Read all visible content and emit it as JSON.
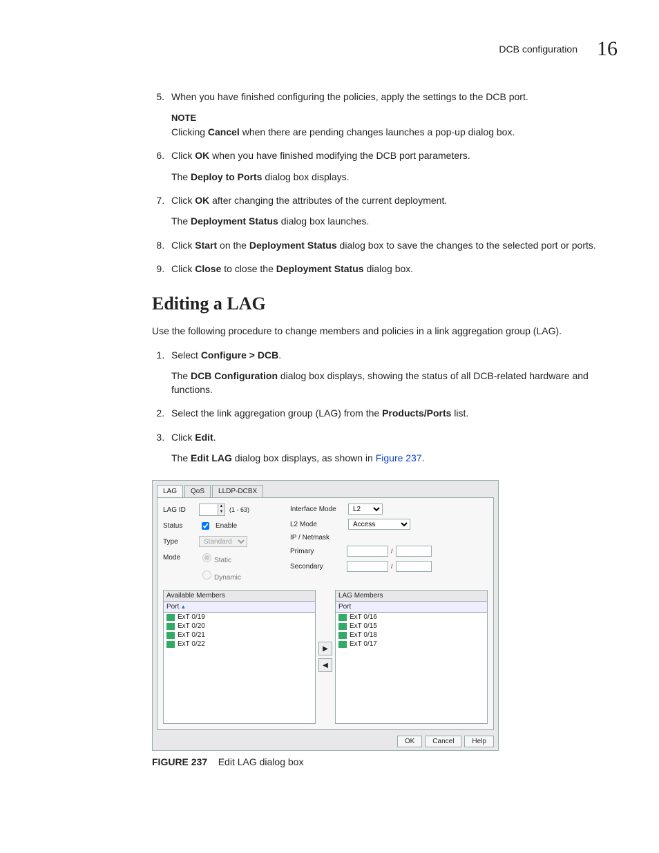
{
  "header": {
    "title": "DCB configuration",
    "chapter": "16"
  },
  "step5": {
    "text": "When you have finished configuring the policies, apply the settings to the DCB port.",
    "note_label": "NOTE",
    "note_a": "Clicking ",
    "note_bold": "Cancel",
    "note_b": " when there are pending changes launches a pop-up dialog box."
  },
  "step6": {
    "a": "Click ",
    "b1": "OK",
    "c": " when you have finished modifying the DCB port parameters.",
    "sub_a": "The ",
    "sub_b": "Deploy to Ports",
    "sub_c": " dialog box displays."
  },
  "step7": {
    "a": "Click ",
    "b1": "OK",
    "c": " after changing the attributes of the current deployment.",
    "sub_a": "The ",
    "sub_b": "Deployment Status",
    "sub_c": " dialog box launches."
  },
  "step8": {
    "a": "Click ",
    "b1": "Start",
    "c": " on the ",
    "b2": "Deployment Status",
    "d": " dialog box to save the changes to the selected port or ports."
  },
  "step9": {
    "a": "Click ",
    "b1": "Close",
    "c": " to close the ",
    "b2": "Deployment Status",
    "d": " dialog box."
  },
  "section_title": "Editing a LAG",
  "intro": "Use the following procedure to change members and policies in a link aggregation group (LAG).",
  "p1": {
    "a": "Select ",
    "b": "Configure > DCB",
    "c": ".",
    "sub_a": "The ",
    "sub_b": "DCB Configuration",
    "sub_c": " dialog box displays, showing the status of all DCB-related hardware and functions."
  },
  "p2": {
    "a": "Select the link aggregation group (LAG) from the ",
    "b": "Products/Ports",
    "c": " list."
  },
  "p3": {
    "a": "Click ",
    "b": "Edit",
    "c": ".",
    "sub_a": "The ",
    "sub_b": "Edit LAG",
    "sub_c": " dialog box displays, as shown in ",
    "link": "Figure 237",
    "sub_d": "."
  },
  "dialog": {
    "tabs": [
      "LAG",
      "QoS",
      "LLDP-DCBX"
    ],
    "labels": {
      "lag_id": "LAG ID",
      "range": "(1 - 63)",
      "status": "Status",
      "enable": "Enable",
      "type": "Type",
      "type_val": "Standard",
      "mode": "Mode",
      "static": "Static",
      "dynamic": "Dynamic",
      "iface": "Interface Mode",
      "iface_val": "L2",
      "l2mode": "L2 Mode",
      "l2mode_val": "Access",
      "ipnet": "IP / Netmask",
      "primary": "Primary",
      "secondary": "Secondary",
      "avail": "Available Members",
      "lagmembers": "LAG Members",
      "port": "Port"
    },
    "left_items": [
      "ExT 0/19",
      "ExT 0/20",
      "ExT 0/21",
      "ExT 0/22"
    ],
    "right_items": [
      "ExT 0/16",
      "ExT 0/15",
      "ExT 0/18",
      "ExT 0/17"
    ],
    "buttons": {
      "ok": "OK",
      "cancel": "Cancel",
      "help": "Help"
    }
  },
  "figure": {
    "label": "FIGURE 237",
    "caption": "Edit LAG dialog box"
  }
}
